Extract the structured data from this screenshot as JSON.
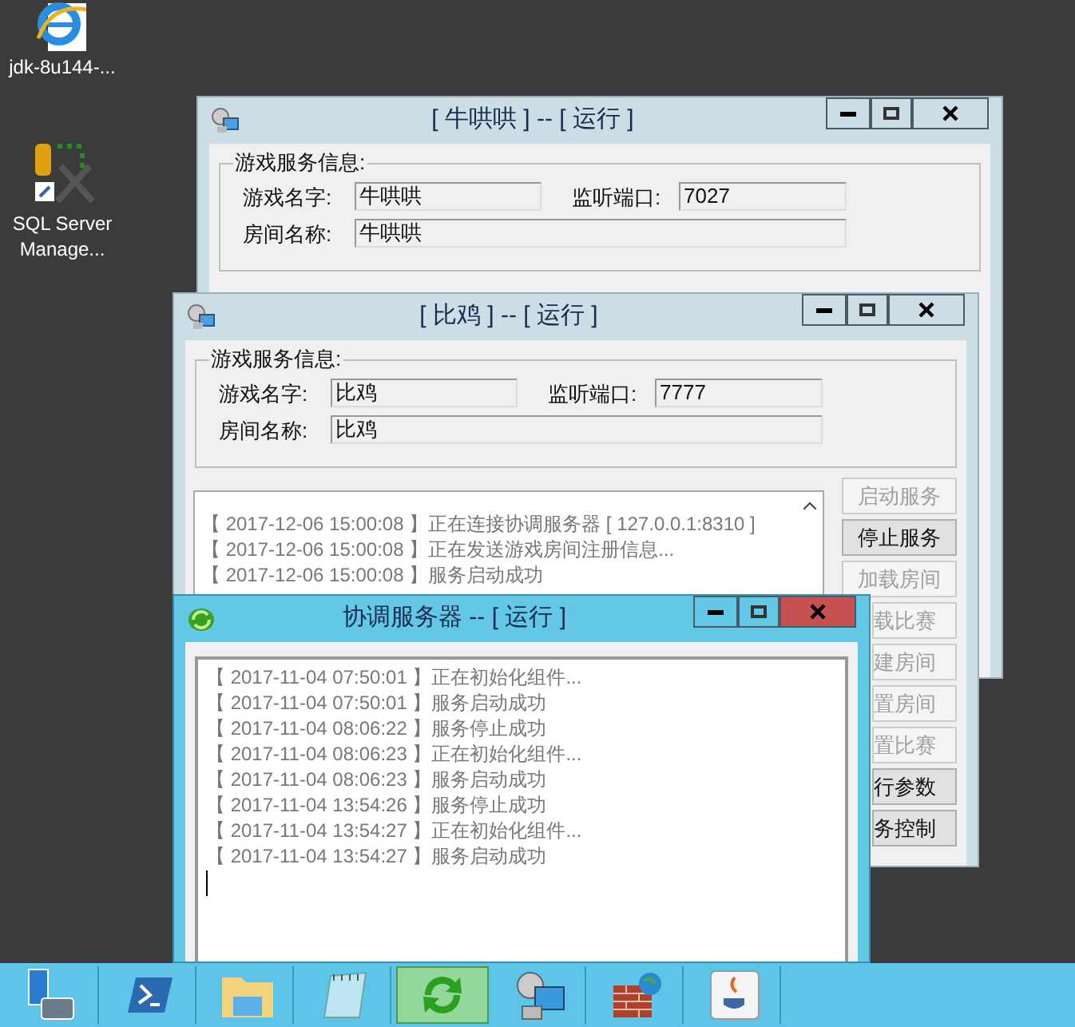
{
  "desktop_icons": [
    {
      "label": "jdk-8u144-...",
      "kind": "browser"
    },
    {
      "label": "SQL Server Manage...",
      "kind": "sqltools"
    }
  ],
  "windows": [
    {
      "title": "[ 牛哄哄 ] -- [ 运行 ]",
      "active": false,
      "kind": "game",
      "group_title": "游戏服务信息:",
      "game_name_label": "游戏名字:",
      "game_name": "牛哄哄",
      "port_label": "监听端口:",
      "port": "7027",
      "room_label": "房间名称:",
      "room": "牛哄哄"
    },
    {
      "title": "[ 比鸡 ] -- [ 运行 ]",
      "active": false,
      "kind": "game",
      "group_title": "游戏服务信息:",
      "game_name_label": "游戏名字:",
      "game_name": "比鸡",
      "port_label": "监听端口:",
      "port": "7777",
      "room_label": "房间名称:",
      "room": "比鸡",
      "log": [
        "【 2017-12-06 15:00:08 】正在连接协调服务器 [ 127.0.0.1:8310 ]",
        "【 2017-12-06 15:00:08 】正在发送游戏房间注册信息...",
        "【 2017-12-06 15:00:08 】服务启动成功"
      ],
      "buttons": [
        {
          "label": "启动服务",
          "disabled": true
        },
        {
          "label": "停止服务",
          "disabled": false
        },
        {
          "label": "加载房间",
          "disabled": true
        },
        {
          "label": "载比赛",
          "disabled": true
        },
        {
          "label": "建房间",
          "disabled": true
        },
        {
          "label": "置房间",
          "disabled": true
        },
        {
          "label": "置比赛",
          "disabled": true
        },
        {
          "label": "行参数",
          "disabled": false
        },
        {
          "label": "务控制",
          "disabled": false
        }
      ]
    },
    {
      "title": "协调服务器 -- [ 运行 ]",
      "active": true,
      "kind": "log",
      "log": [
        "【 2017-11-04 07:50:01 】正在初始化组件...",
        "【 2017-11-04 07:50:01 】服务启动成功",
        "【 2017-11-04 08:06:22 】服务停止成功",
        "【 2017-11-04 08:06:23 】正在初始化组件...",
        "【 2017-11-04 08:06:23 】服务启动成功",
        "【 2017-11-04 13:54:26 】服务停止成功",
        "【 2017-11-04 13:54:27 】正在初始化组件...",
        "【 2017-11-04 13:54:27 】服务启动成功"
      ]
    }
  ],
  "taskbar": [
    {
      "kind": "server-manager",
      "selected": false
    },
    {
      "kind": "powershell",
      "selected": false
    },
    {
      "kind": "folder",
      "selected": false
    },
    {
      "kind": "notepad",
      "selected": false
    },
    {
      "kind": "sync",
      "selected": true
    },
    {
      "kind": "network",
      "selected": false
    },
    {
      "kind": "firewall",
      "selected": false
    },
    {
      "kind": "java",
      "selected": false
    }
  ]
}
